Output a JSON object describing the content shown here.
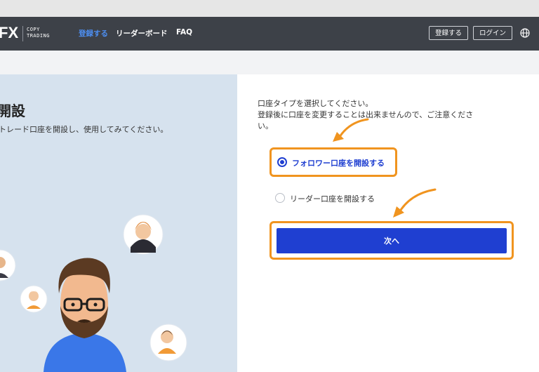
{
  "header": {
    "logo_text": "FX",
    "logo_sub_line1": "COPY",
    "logo_sub_line2": "TRADING",
    "nav": [
      {
        "label": "登録する",
        "active": true
      },
      {
        "label": "リーダーボード",
        "active": false
      },
      {
        "label": "FAQ",
        "active": false
      }
    ],
    "register_button": "登録する",
    "login_button": "ログイン",
    "language_icon": "globe-icon"
  },
  "left": {
    "title": "開設",
    "subtitle": "トレード口座を開設し、使用してみてください。"
  },
  "form": {
    "instruction_line1": "口座タイプを選択してください。",
    "instruction_line2": "登録後に口座を変更することは出来ませんので、ご注意くださ",
    "instruction_line3": "い。",
    "options": [
      {
        "label": "フォロワー口座を開設する",
        "selected": true
      },
      {
        "label": "リーダー口座を開設する",
        "selected": false
      }
    ],
    "next_button": "次へ"
  },
  "colors": {
    "header_bg": "#3d4148",
    "accent_blue": "#1f3fd1",
    "nav_active": "#4d8ef0",
    "highlight_orange": "#f0941f",
    "left_panel_bg": "#d6e2ee"
  }
}
